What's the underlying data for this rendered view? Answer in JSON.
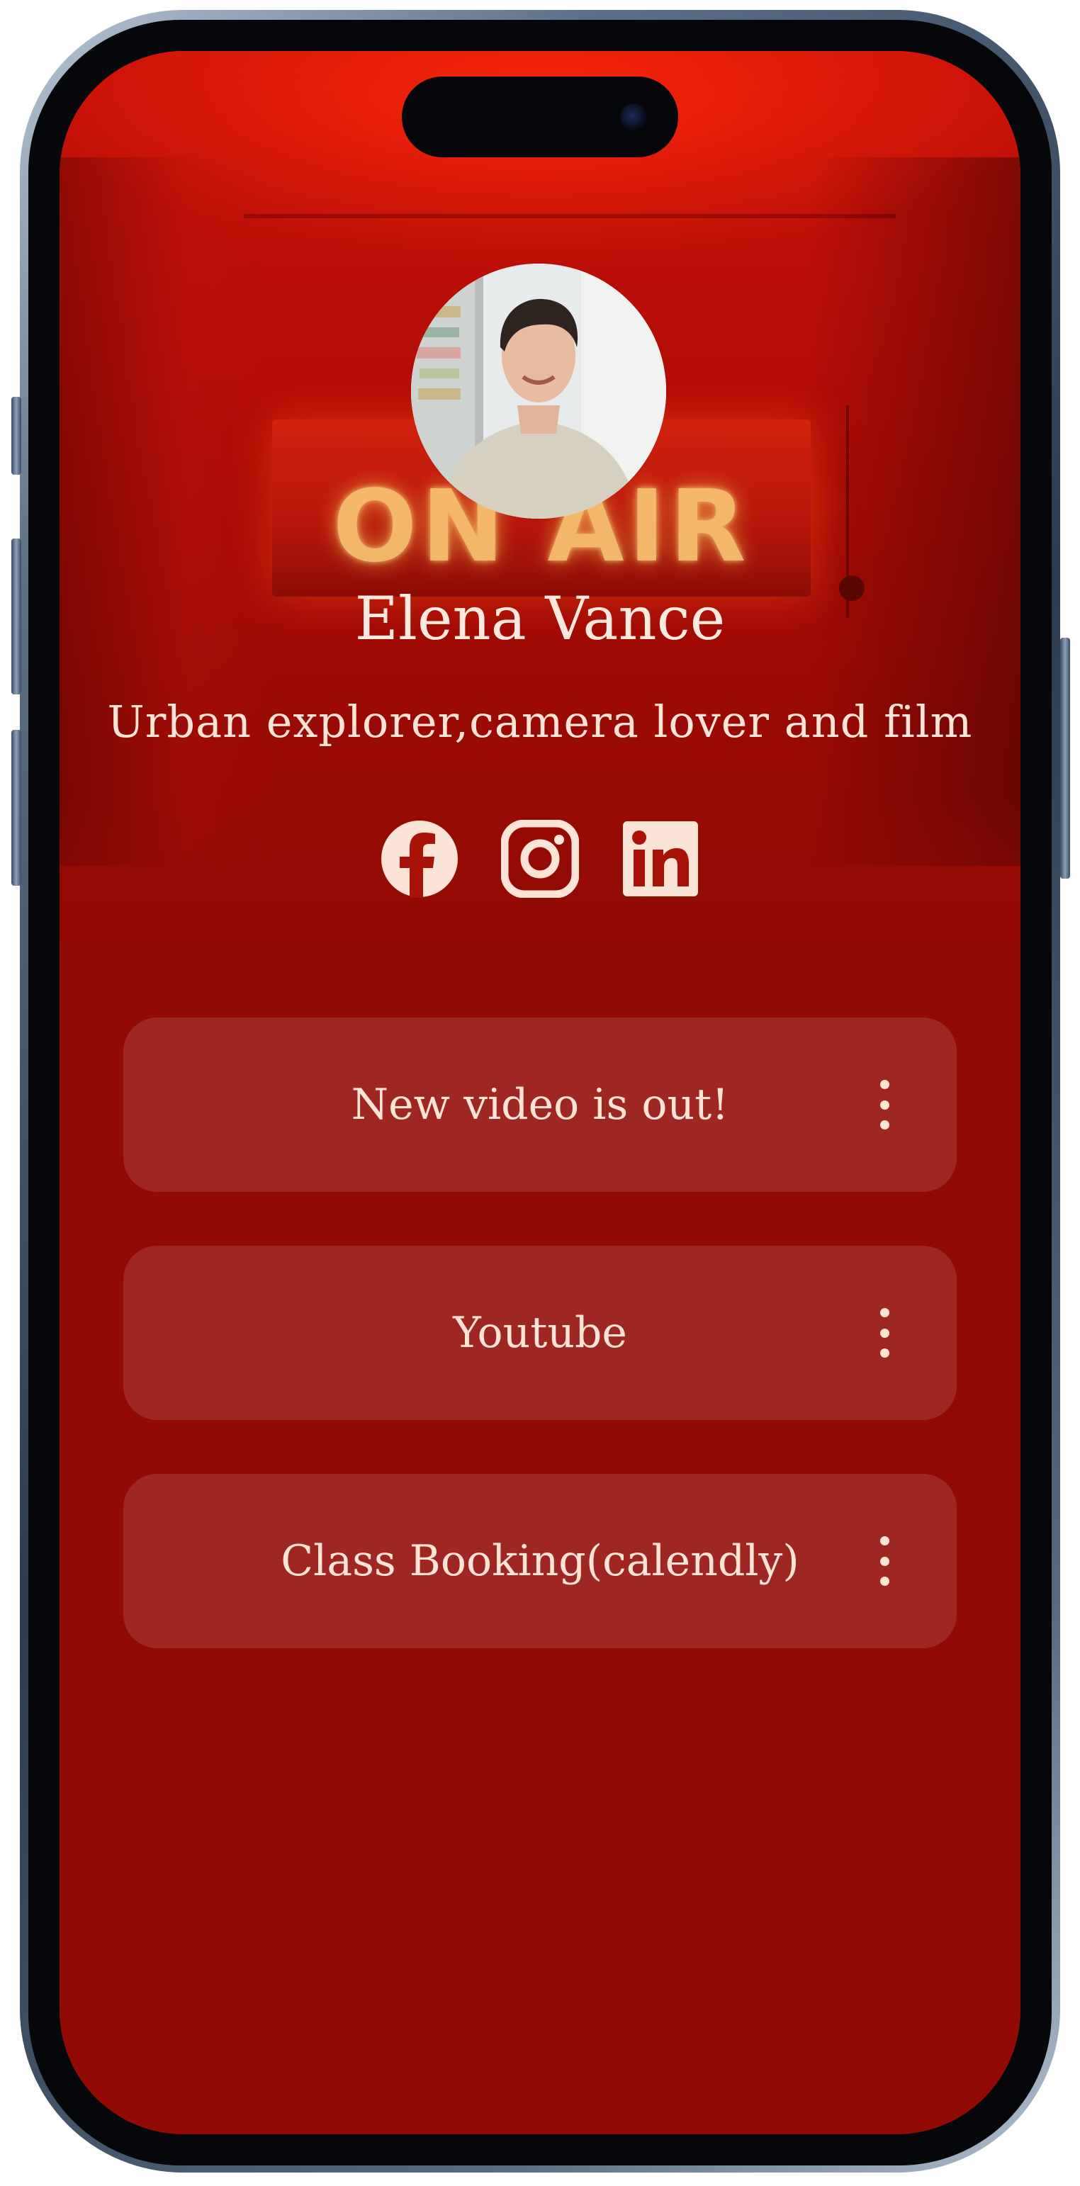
{
  "profile": {
    "name": "Elena Vance",
    "bio": "Urban explorer,camera lover and film"
  },
  "hero": {
    "sign_text": "ON AIR"
  },
  "socials": [
    {
      "icon": "facebook-icon"
    },
    {
      "icon": "instagram-icon"
    },
    {
      "icon": "linkedin-icon"
    }
  ],
  "links": [
    {
      "label": "New video is out!",
      "menu_icon": "kebab-menu-icon"
    },
    {
      "label": "Youtube",
      "menu_icon": "kebab-menu-icon"
    },
    {
      "label": "Class Booking(calendly)",
      "menu_icon": "kebab-menu-icon"
    }
  ],
  "colors": {
    "background": "#920a05",
    "hero_red": "#c81208",
    "text": "#fbe8de",
    "card": "rgba(255,255,255,0.12)"
  }
}
